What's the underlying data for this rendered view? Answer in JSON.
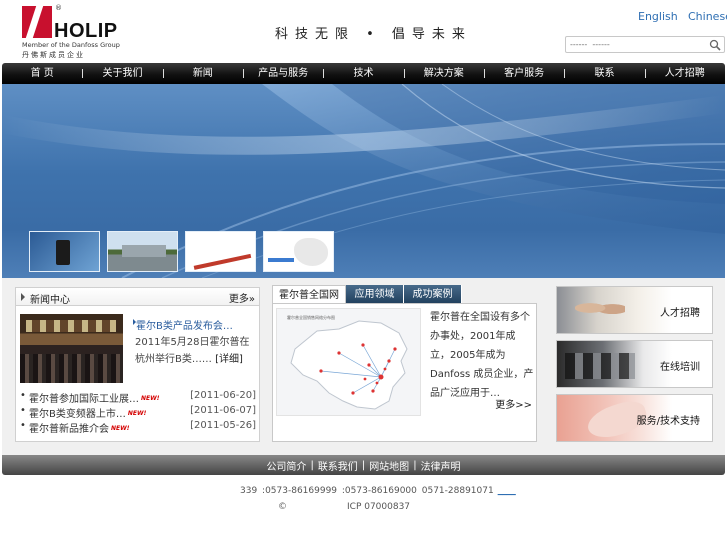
{
  "header": {
    "logo": {
      "brand": "HOLIP",
      "registered": "®",
      "member_line": "Member of the Danfoss Group",
      "cn_line": "丹佛斯成员企业"
    },
    "slogan": "科技无限 • 倡导未来",
    "languages": [
      "English",
      "Chinese"
    ],
    "search": {
      "value": "------  ------"
    }
  },
  "nav": {
    "items": [
      "首 页",
      "关于我们",
      "新闻",
      "产品与服务",
      "技术",
      "解决方案",
      "客户服务",
      "联系",
      "人才招聘"
    ]
  },
  "banner": {
    "thumbnails": [
      "thumb-1",
      "thumb-2",
      "thumb-3",
      "thumb-4"
    ]
  },
  "news": {
    "title": "新闻中心",
    "more": "更多»",
    "headline": "霍尔B类产品发布会…",
    "summary": "2011年5月28日霍尔普在杭州举行B类…… [详细]",
    "summary_main": "2011年5月28日霍尔普在杭州举行B类……",
    "detail_label": "[详细]",
    "items": [
      {
        "title": "霍尔普参加国际工业展…",
        "new": "NEW!",
        "date": "[2011-06-20]"
      },
      {
        "title": "霍尔B类变频器上市…",
        "new": "NEW!",
        "date": "[2011-06-07]"
      },
      {
        "title": "霍尔普新品推介会",
        "new": "NEW!",
        "date": "[2011-05-26]"
      }
    ]
  },
  "tabs": {
    "labels": [
      "霍尔普全国网",
      "应用领域",
      "成功案例"
    ],
    "active": 0,
    "map_caption": "霍尔普全国销售网络分布图",
    "intro": "霍尔普在全国设有多个办事处，2001年成立，2005年成为Danfoss 成员企业，产品广泛应用于…",
    "more": "更多>>"
  },
  "side_links": [
    {
      "label": "人才招聘"
    },
    {
      "label": "在线培训"
    },
    {
      "label": "服务/技术支持"
    }
  ],
  "footer": {
    "links": [
      "公司简介",
      "联系我们",
      "网站地图",
      "法律声明"
    ],
    "line1": "339    :0573-86169999  :0573-86169000     0571-28891071",
    "line1_link": "____",
    "copyright": "©",
    "icp": "ICP 07000837"
  },
  "colors": {
    "accent_blue": "#2f6fb3",
    "nav_black": "#111111",
    "brand_red": "#c8102e",
    "banner_blue": "#3f73ad"
  }
}
